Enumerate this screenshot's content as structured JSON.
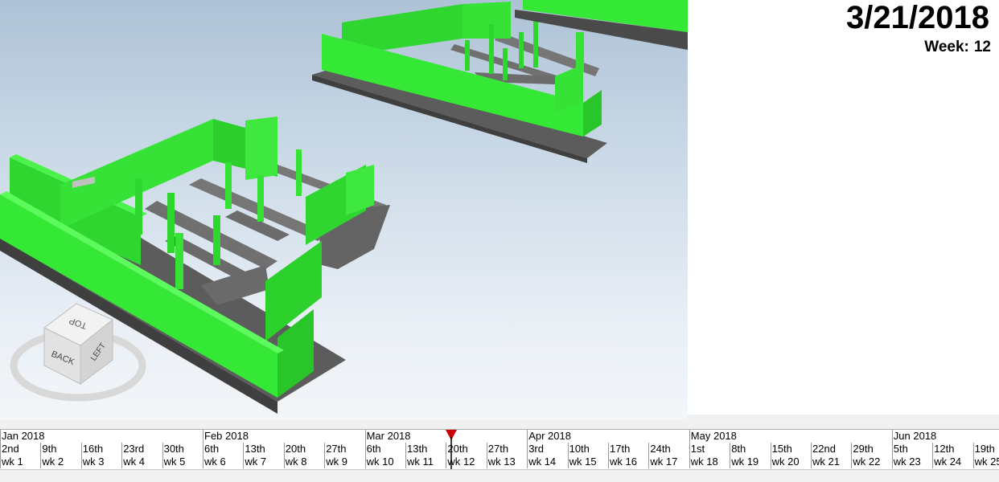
{
  "header": {
    "date": "3/21/2018",
    "week_prefix": "Week:",
    "week_number": "12"
  },
  "viewcube": {
    "faces": [
      "TOP",
      "BACK",
      "LEFT"
    ]
  },
  "timeline": {
    "months": [
      "Jan 2018",
      "Feb 2018",
      "Mar 2018",
      "Apr 2018",
      "May 2018",
      "Jun 2018"
    ],
    "days": [
      "2nd",
      "9th",
      "16th",
      "23rd",
      "30th",
      "6th",
      "13th",
      "20th",
      "27th",
      "6th",
      "13th",
      "20th",
      "27th",
      "3rd",
      "10th",
      "17th",
      "24th",
      "1st",
      "8th",
      "15th",
      "22nd",
      "29th",
      "5th",
      "12th",
      "19th"
    ],
    "weeks": [
      "wk 1",
      "wk 2",
      "wk 3",
      "wk 4",
      "wk 5",
      "wk 6",
      "wk 7",
      "wk 8",
      "wk 9",
      "wk 10",
      "wk 11",
      "wk 12",
      "wk 13",
      "wk 14",
      "wk 15",
      "wk 16",
      "wk 17",
      "wk 18",
      "wk 19",
      "wk 20",
      "wk 21",
      "wk 22",
      "wk 23",
      "wk 24",
      "wk 25"
    ],
    "current_week_index": 11
  },
  "colors": {
    "wall_green": "#33ee33",
    "foundation_gray": "#6e6e6e",
    "marker_red": "#cc0000"
  }
}
